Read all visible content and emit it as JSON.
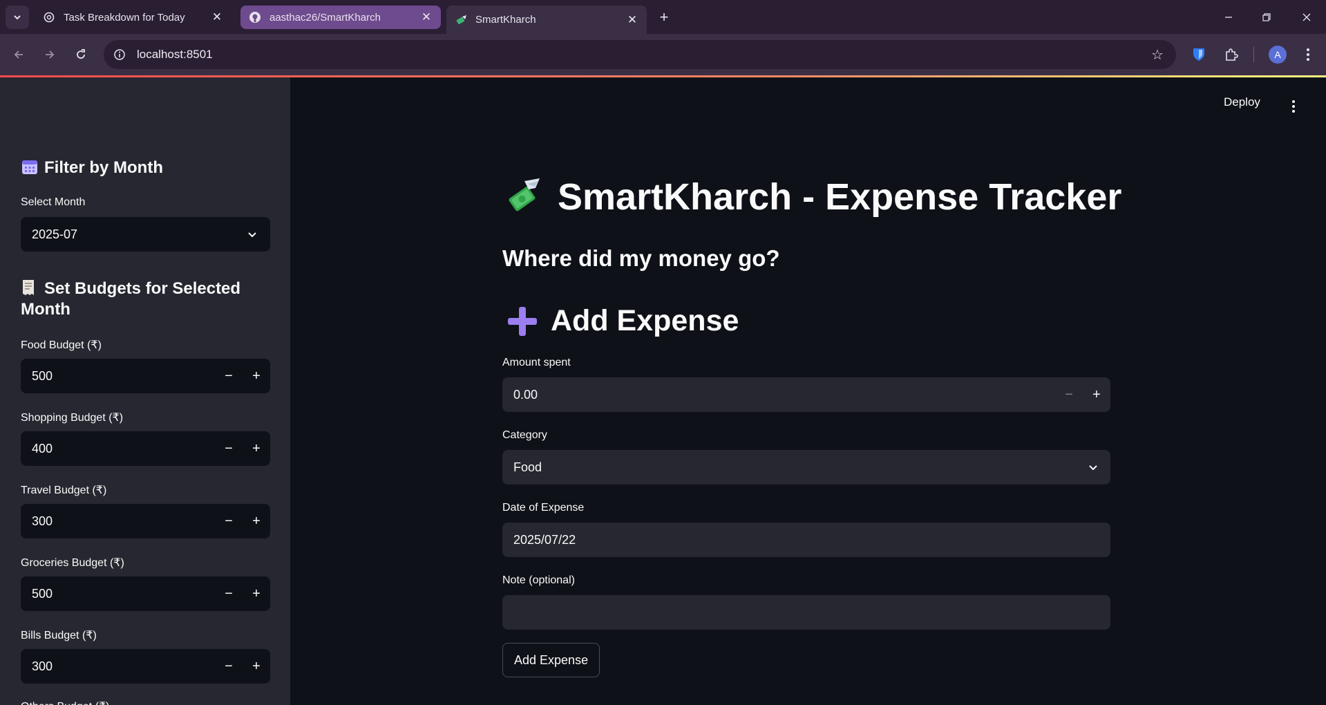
{
  "browser": {
    "tabs": [
      {
        "title": "Task Breakdown for Today"
      },
      {
        "title": "aasthac26/SmartKharch"
      },
      {
        "title": "SmartKharch"
      }
    ],
    "url": "localhost:8501",
    "profile_initial": "A"
  },
  "app": {
    "deploy_label": "Deploy",
    "title": "SmartKharch - Expense Tracker",
    "subtitle": "Where did my money go?",
    "add_expense_heading": "Add Expense"
  },
  "sidebar": {
    "filter_heading": "Filter by Month",
    "select_month_label": "Select Month",
    "selected_month": "2025-07",
    "budgets_heading": "Set Budgets for Selected Month",
    "budgets": [
      {
        "label": "Food Budget (₹)",
        "value": "500"
      },
      {
        "label": "Shopping Budget (₹)",
        "value": "400"
      },
      {
        "label": "Travel Budget (₹)",
        "value": "300"
      },
      {
        "label": "Groceries Budget (₹)",
        "value": "500"
      },
      {
        "label": "Bills Budget (₹)",
        "value": "300"
      }
    ],
    "cutoff_label": "Others Budget (₹)"
  },
  "form": {
    "amount_label": "Amount spent",
    "amount_value": "0.00",
    "category_label": "Category",
    "category_value": "Food",
    "date_label": "Date of Expense",
    "date_value": "2025/07/22",
    "note_label": "Note (optional)",
    "note_value": "",
    "submit_label": "Add Expense"
  },
  "icons": {
    "filter_icon": "calendar-icon",
    "budget_icon": "receipt-icon",
    "title_icon": "money-with-wings-icon",
    "add_icon": "plus-icon"
  }
}
